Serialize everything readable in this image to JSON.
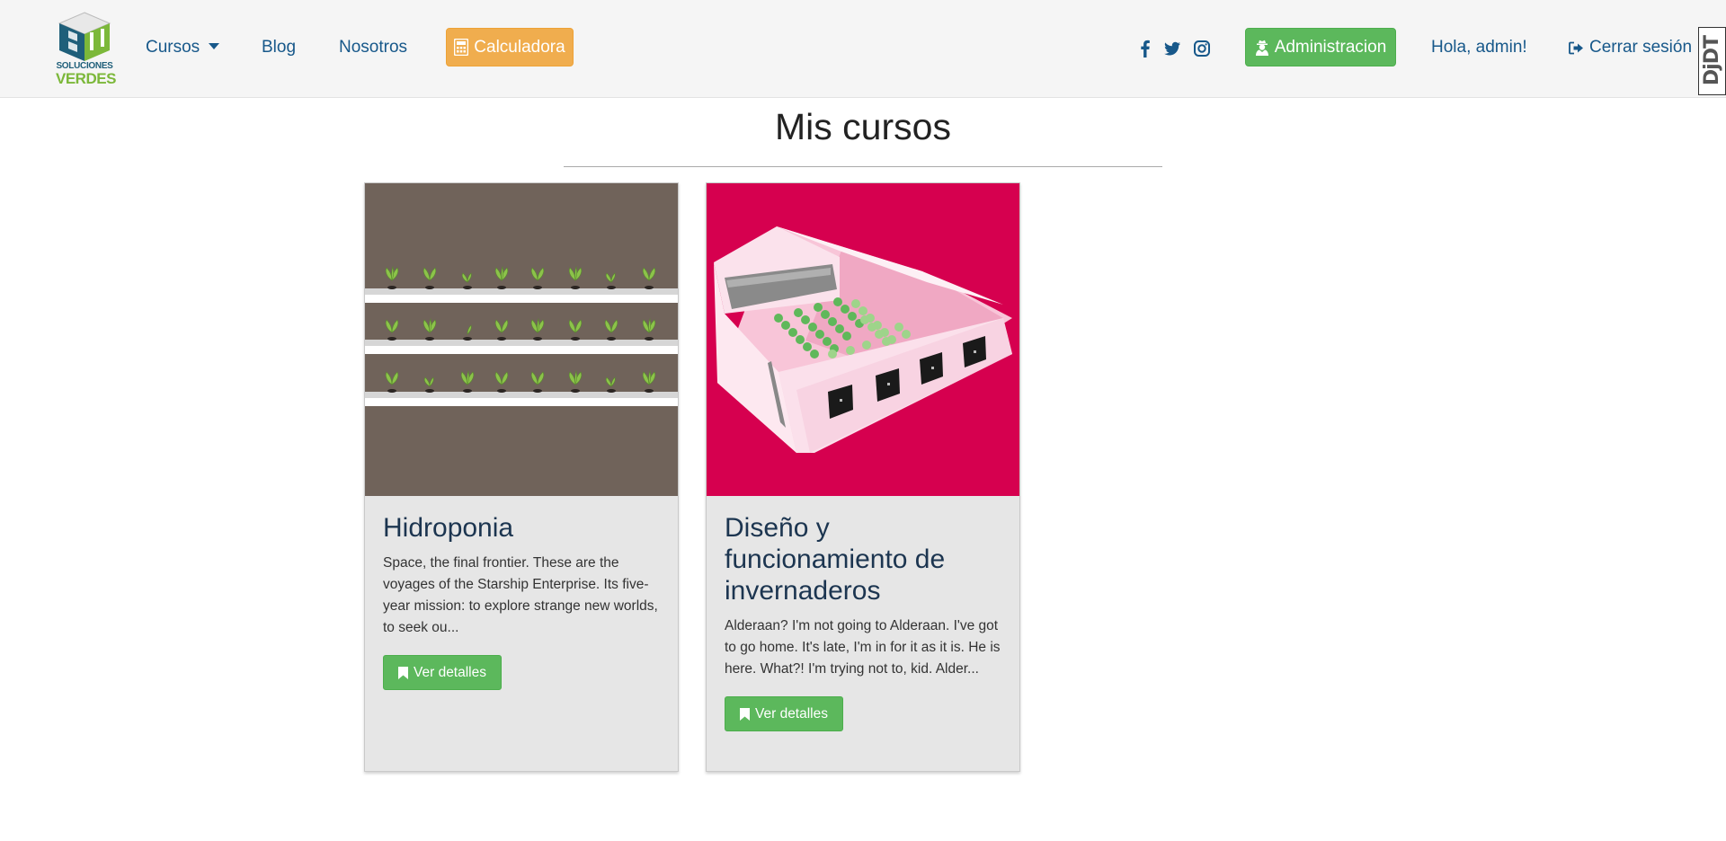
{
  "nav": {
    "logo_line1": "SOLUCIONES",
    "logo_line2": "VERDES",
    "cursos_label": "Cursos",
    "blog_label": "Blog",
    "nosotros_label": "Nosotros",
    "calculadora_label": "Calculadora",
    "admin_label": "Administracion",
    "greeting": "Hola, admin!",
    "logout_label": "Cerrar sesión",
    "social_icons": [
      "facebook-icon",
      "twitter-icon",
      "instagram-icon"
    ],
    "debug_badge": "DjDT"
  },
  "page": {
    "title": "Mis cursos"
  },
  "courses": [
    {
      "title": "Hidroponia",
      "description": "Space, the final frontier. These are the voyages of the Starship Enterprise. Its five-year mission: to explore strange new worlds, to seek ou...",
      "button_label": "Ver detalles"
    },
    {
      "title": "Diseño y funcionamiento de invernaderos",
      "description": "Alderaan? I'm not going to Alderaan. I've got to go home. It's late, I'm in for it as it is. He is here. What?! I'm trying not to, kid. Alder...",
      "button_label": "Ver detalles"
    }
  ],
  "colors": {
    "navbar_bg": "#f5f5f5",
    "link": "#17588a",
    "warning": "#f0ad4e",
    "success": "#5cb85c",
    "card_bg": "#e6e6e6"
  }
}
